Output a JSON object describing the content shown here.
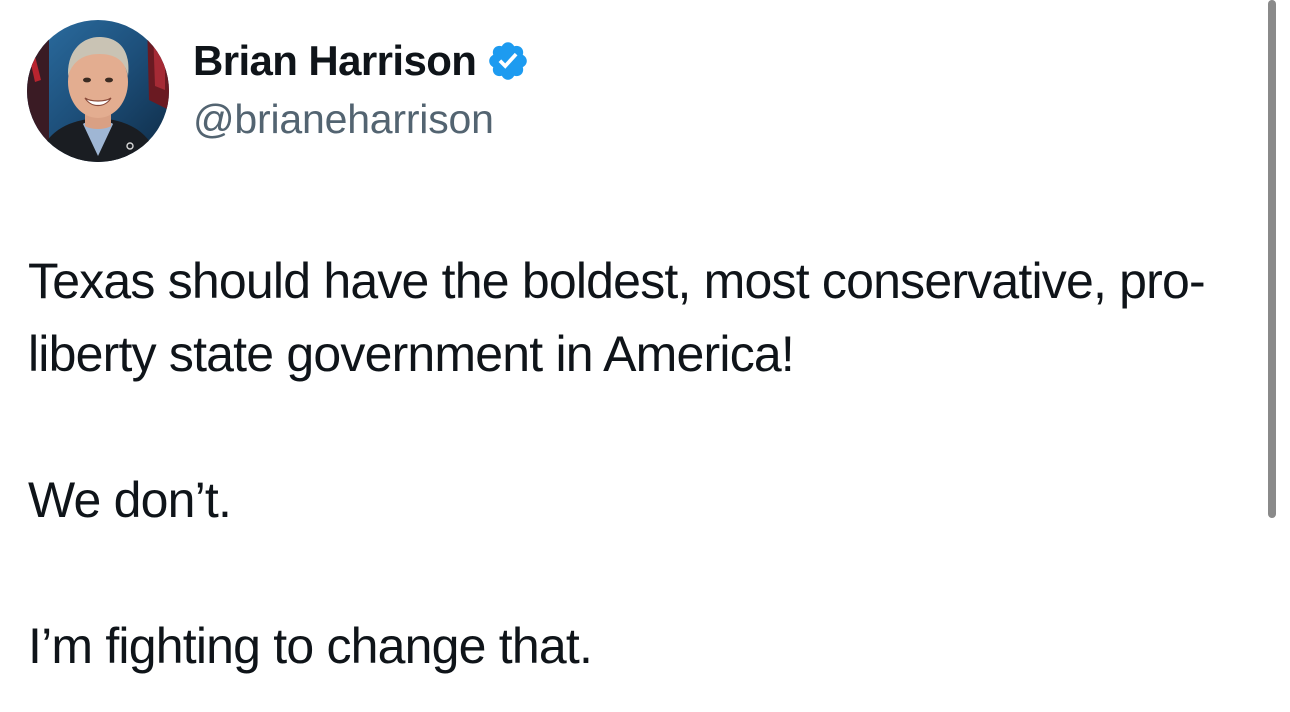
{
  "tweet": {
    "author": {
      "display_name": "Brian Harrison",
      "handle": "@brianeharrison",
      "verified": true,
      "verified_color": "#1d9bf0",
      "avatar_icon": "profile-photo"
    },
    "paragraphs": [
      "Texas should have the boldest, most conservative, pro-liberty state government in America!",
      "We don’t.",
      "I’m fighting to change that."
    ]
  },
  "colors": {
    "text": "#0f1419",
    "secondary_text": "#536471",
    "background": "#ffffff",
    "scrollbar": "#8a8a8a"
  }
}
